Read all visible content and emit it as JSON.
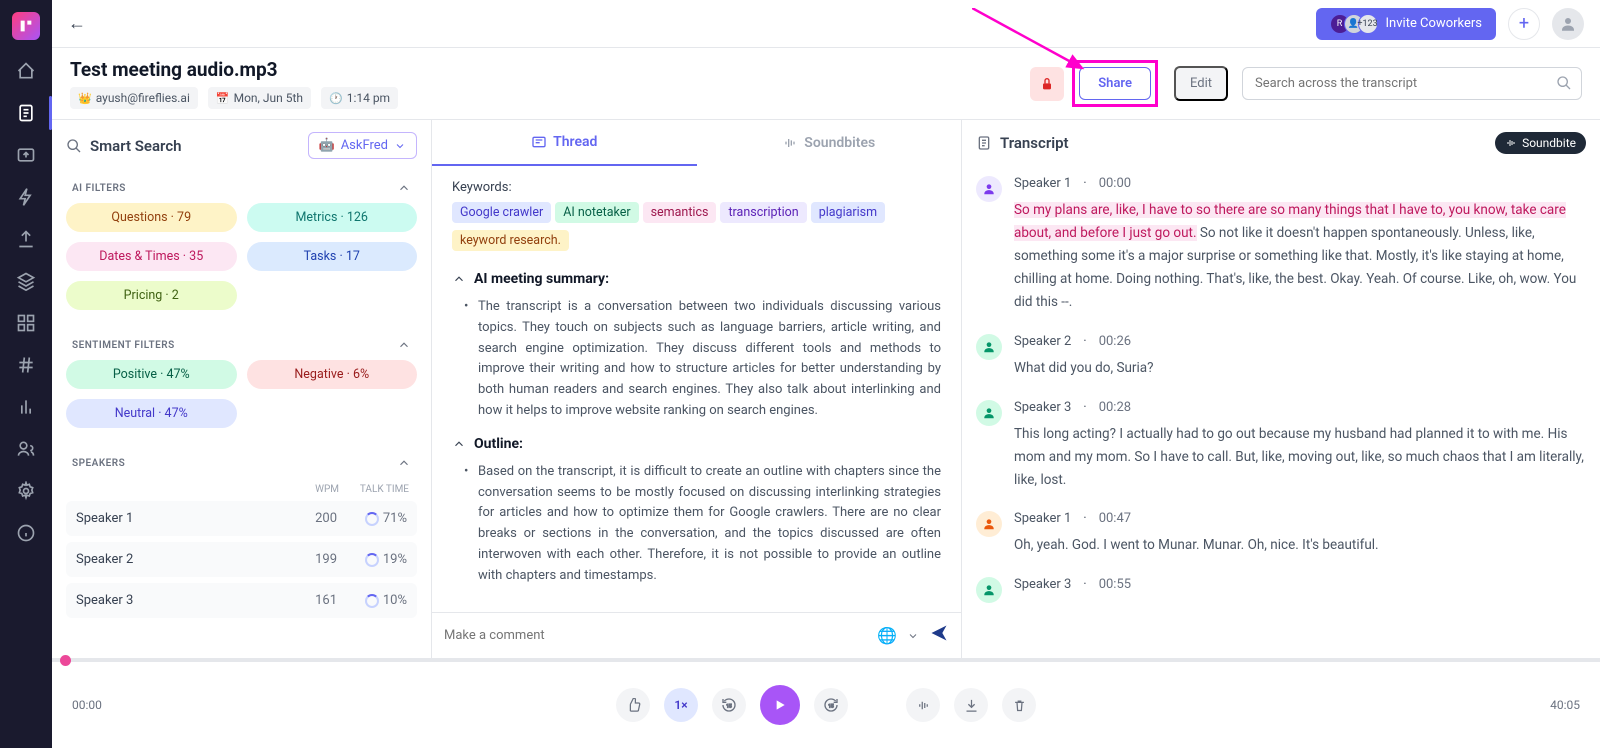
{
  "topbar": {
    "invite_label": "Invite Coworkers",
    "badge_count": "+123",
    "badge_initial": "R"
  },
  "header": {
    "title": "Test meeting audio.mp3",
    "owner": "ayush@fireflies.ai",
    "date": "Mon, Jun 5th",
    "time": "1:14 pm",
    "share": "Share",
    "edit": "Edit",
    "search_placeholder": "Search across the transcript"
  },
  "sidebar": {
    "smart_search": "Smart Search",
    "askfred": "AskFred",
    "ai_filters_title": "AI FILTERS",
    "filters": [
      {
        "label": "Questions · 79",
        "cls": "chip-yellow"
      },
      {
        "label": "Metrics · 126",
        "cls": "chip-teal"
      },
      {
        "label": "Dates & Times · 35",
        "cls": "chip-pink"
      },
      {
        "label": "Tasks · 17",
        "cls": "chip-blue"
      },
      {
        "label": "Pricing · 2",
        "cls": "chip-lime"
      }
    ],
    "sentiment_title": "SENTIMENT FILTERS",
    "sentiments": [
      {
        "label": "Positive · 47%",
        "cls": "chip-green"
      },
      {
        "label": "Negative · 6%",
        "cls": "chip-red"
      },
      {
        "label": "Neutral · 47%",
        "cls": "chip-violet"
      }
    ],
    "speakers_title": "SPEAKERS",
    "speakers_wpm": "WPM",
    "speakers_tt": "TALK TIME",
    "speakers": [
      {
        "name": "Speaker 1",
        "wpm": "200",
        "tt": "71%"
      },
      {
        "name": "Speaker 2",
        "wpm": "199",
        "tt": "19%"
      },
      {
        "name": "Speaker 3",
        "wpm": "161",
        "tt": "10%"
      }
    ]
  },
  "thread": {
    "tab_thread": "Thread",
    "tab_soundbites": "Soundbites",
    "keywords_label": "Keywords:",
    "keywords": [
      {
        "t": "Google crawler",
        "c": "kw1"
      },
      {
        "t": "AI notetaker",
        "c": "kw2"
      },
      {
        "t": "semantics",
        "c": "kw3"
      },
      {
        "t": "transcription",
        "c": "kw4"
      },
      {
        "t": "plagiarism",
        "c": "kw1"
      },
      {
        "t": "keyword research.",
        "c": "kw5"
      }
    ],
    "summary_title": "AI meeting summary:",
    "summary_body": "The transcript is a conversation between two individuals discussing various topics. They touch on subjects such as language barriers, article writing, and search engine optimization. They discuss different tools and methods to improve their writing and how to structure articles for better understanding by both human readers and search engines. They also talk about interlinking and how it helps to improve website ranking on search engines.",
    "outline_title": "Outline:",
    "outline_body": "Based on the transcript, it is difficult to create an outline with chapters since the conversation seems to be mostly focused on discussing interlinking strategies for articles and how to optimize them for Google crawlers. There are no clear breaks or sections in the conversation, and the topics discussed are often interwoven with each other. Therefore, it is not possible to provide an outline with chapters and timestamps.",
    "comment_placeholder": "Make a comment"
  },
  "transcript": {
    "title": "Transcript",
    "soundbite": "Soundbite",
    "blocks": [
      {
        "speaker": "Speaker 1",
        "time": "00:00",
        "av": "",
        "text_hl": "So my plans are, like, I have to so there are so many things that I have to, you know, take care about, and before I just go out.",
        "text": " So not like it doesn't happen spontaneously. Unless, like, something some it's a major surprise or something like that. Mostly, it's like staying at home, chilling at home. Doing nothing. That's, like, the best. Okay. Yeah. Of course. Like, oh, wow. You did this --."
      },
      {
        "speaker": "Speaker 2",
        "time": "00:26",
        "av": "g",
        "text_hl": "",
        "text": "What did you do, Suria?"
      },
      {
        "speaker": "Speaker 3",
        "time": "00:28",
        "av": "g",
        "text_hl": "",
        "text": "This long acting? I actually had to go out because my husband had planned it to with me. His mom and my mom. So I have to call. But, like, moving out, like, so much chaos that I am literally, like, lost."
      },
      {
        "speaker": "Speaker 1",
        "time": "00:47",
        "av": "o",
        "text_hl": "",
        "text": "Oh, yeah. God. I went to Munar. Munar. Oh, nice. It's beautiful."
      },
      {
        "speaker": "Speaker 3",
        "time": "00:55",
        "av": "g",
        "text_hl": "",
        "text": ""
      }
    ]
  },
  "player": {
    "start": "00:00",
    "end": "40:05",
    "speed": "1×"
  }
}
